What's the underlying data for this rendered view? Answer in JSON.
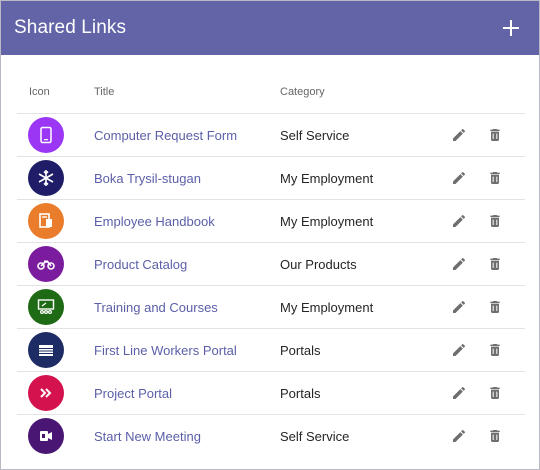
{
  "header": {
    "title": "Shared Links",
    "add_icon": "plus-icon"
  },
  "columns": {
    "icon": "Icon",
    "title": "Title",
    "category": "Category"
  },
  "rows": [
    {
      "title": "Computer Request Form",
      "category": "Self Service",
      "icon": "tablet-icon",
      "color": "#9b36f5"
    },
    {
      "title": "Boka Trysil-stugan",
      "category": "My Employment",
      "icon": "snowflake-icon",
      "color": "#1f1d67"
    },
    {
      "title": "Employee Handbook",
      "category": "My Employment",
      "icon": "handbook-icon",
      "color": "#ea7d2c"
    },
    {
      "title": "Product Catalog",
      "category": "Our Products",
      "icon": "motorbike-icon",
      "color": "#7b1b9e"
    },
    {
      "title": "Training and Courses",
      "category": "My Employment",
      "icon": "presentation-icon",
      "color": "#1f6a14"
    },
    {
      "title": "First Line Workers Portal",
      "category": "Portals",
      "icon": "garage-icon",
      "color": "#1d2c64"
    },
    {
      "title": "Project Portal",
      "category": "Portals",
      "icon": "double-chevron-icon",
      "color": "#d4124d"
    },
    {
      "title": "Start New Meeting",
      "category": "Self Service",
      "icon": "meeting-icon",
      "color": "#4a1673"
    }
  ],
  "actions": {
    "edit_icon": "pencil-icon",
    "delete_icon": "trash-icon",
    "icon_color": "#6e6e6e"
  },
  "colors": {
    "header_bg": "#6264a7",
    "link": "#5b5fa8"
  }
}
